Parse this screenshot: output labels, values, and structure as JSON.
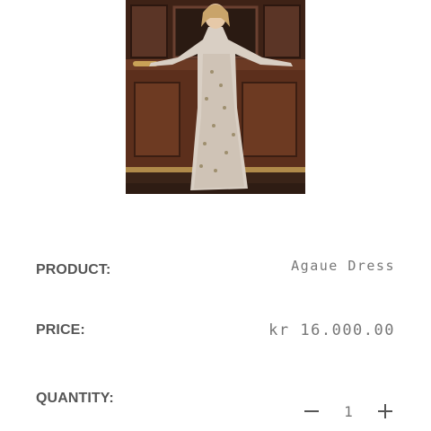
{
  "product_image": {
    "alt": "",
    "icon": "product-photo"
  },
  "details": {
    "product_label": "PRODUCT:",
    "product_value": "Agaue Dress",
    "price_label": "PRICE:",
    "price_value": "kr 16.000.00",
    "quantity_label": "QUANTITY:",
    "quantity_value": "1"
  },
  "controls": {
    "decrement_icon": "minus-icon",
    "increment_icon": "plus-icon"
  },
  "colors": {
    "label": "#555555",
    "value": "#777777",
    "background": "#ffffff"
  }
}
